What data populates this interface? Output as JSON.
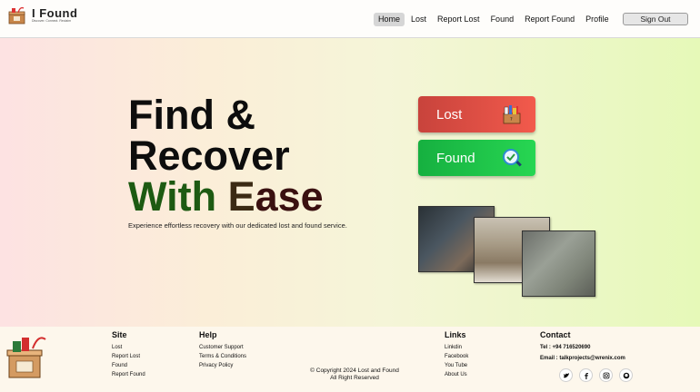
{
  "header": {
    "brand_title": "I Found",
    "brand_subtitle": "Discover. Connect. Reclaim",
    "nav": [
      "Home",
      "Lost",
      "Report Lost",
      "Found",
      "Report Found",
      "Profile"
    ],
    "active_nav": "Home",
    "signout_label": "Sign Out"
  },
  "hero": {
    "title_line1": "Find &",
    "title_line2": "Recover",
    "title_with": "With",
    "title_ease_e": "E",
    "title_ease_rest": "ase",
    "subtitle": "Experience effortless recovery with our dedicated lost and found service."
  },
  "actions": {
    "lost_label": "Lost",
    "found_label": "Found"
  },
  "footer": {
    "site": {
      "heading": "Site",
      "links": [
        "Lost",
        "Report Lost",
        "Found",
        "Report Found"
      ]
    },
    "help": {
      "heading": "Help",
      "links": [
        "Customer Support",
        "Terms & Conditions",
        "Privacy Policy"
      ]
    },
    "links": {
      "heading": "Links",
      "links": [
        "Linkdin",
        "Facebook",
        "You Tube",
        "About Us"
      ]
    },
    "contact": {
      "heading": "Contact",
      "phone": "Tel : +94 716520690",
      "email": "Email : talkprojects@wrenix.com"
    },
    "copyright_line1": "© Copyright 2024 Lost and Found",
    "copyright_line2": "All Right Reserved",
    "socials": [
      "twitter-icon",
      "facebook-icon",
      "instagram-icon",
      "github-icon"
    ]
  },
  "colors": {
    "lost_button": "#e34b42",
    "found_button": "#1fc448",
    "title_green": "#1d5a12",
    "title_brown": "#3b2a14"
  }
}
